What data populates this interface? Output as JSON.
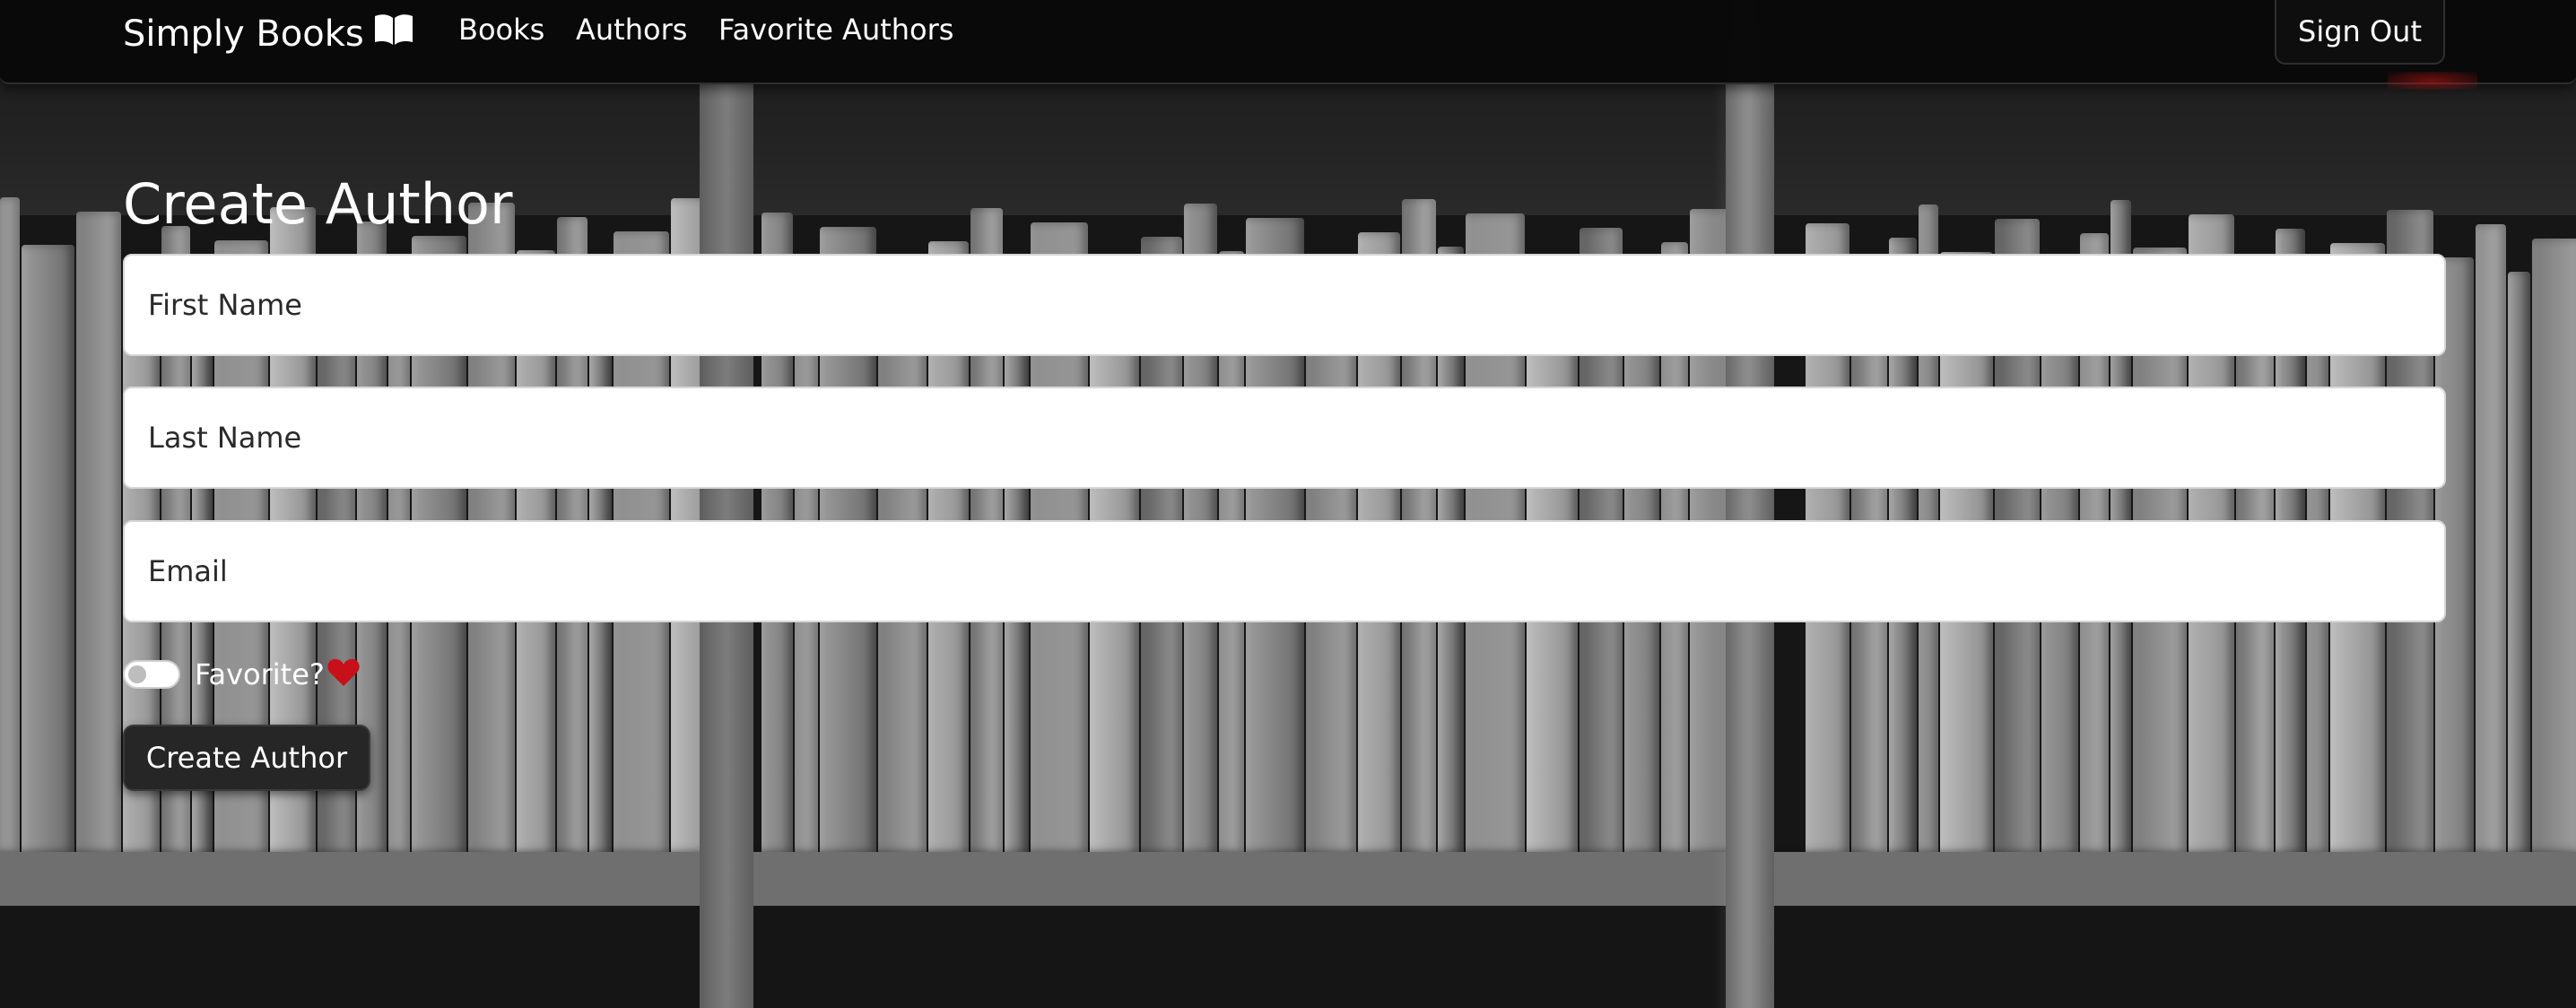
{
  "navbar": {
    "brand": "Simply Books",
    "brand_icon": "open-book-icon",
    "links": [
      "Books",
      "Authors",
      "Favorite Authors"
    ],
    "sign_out_label": "Sign Out"
  },
  "form": {
    "title": "Create Author",
    "first_name_placeholder": "First Name",
    "last_name_placeholder": "Last Name",
    "email_placeholder": "Email",
    "favorite_label": "Favorite?",
    "favorite_checked": false,
    "heart_icon": "heart-icon",
    "heart_color": "#c8101b",
    "submit_label": "Create Author"
  }
}
